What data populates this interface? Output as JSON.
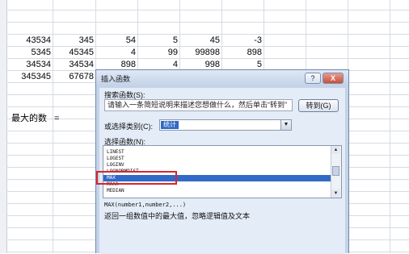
{
  "spreadsheet": {
    "rows": [
      [
        "43534",
        "345",
        "54",
        "5",
        "45",
        "-3"
      ],
      [
        "5345",
        "45345",
        "4",
        "99",
        "99898",
        "898"
      ],
      [
        "34534",
        "34534",
        "898",
        "4",
        "998",
        "5"
      ],
      [
        "345345",
        "67678",
        "",
        "",
        "",
        ""
      ]
    ],
    "max_label": "最大的数",
    "max_formula": "="
  },
  "dialog": {
    "title": "插入函数",
    "help_label": "?",
    "close_label": "X",
    "search_label": "搜索函数(S):",
    "search_value": "请输入一条简短说明来描述您想做什么，然后单击“转到”",
    "goto_label": "转到(G)",
    "category_label": "或选择类别(C):",
    "category_value": "统计",
    "list_label": "选择函数(N):",
    "functions": [
      "LINEST",
      "LOGEST",
      "LOGINV",
      "LOGNORMDIST",
      "MAX",
      "MAXA",
      "MEDIAN"
    ],
    "selected_function": "MAX",
    "syntax": "MAX(number1,number2,...)",
    "description": "返回一组数值中的最大值，忽略逻辑值及文本"
  }
}
